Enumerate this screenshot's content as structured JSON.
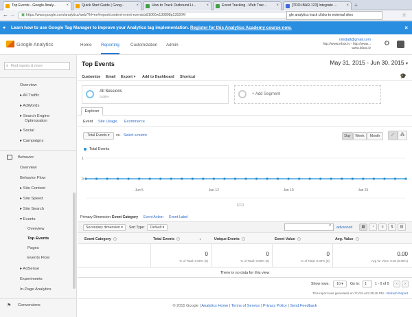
{
  "browser": {
    "tabs": [
      {
        "title": "Top Events - Google Analy...",
        "color": "#f4a400"
      },
      {
        "title": "Quick Start Guide | Goog...",
        "color": "#f4a400"
      },
      {
        "title": "How to Track Outbound Li...",
        "color": "#43a047"
      },
      {
        "title": "Event Tracking - Web Trac...",
        "color": "#43a047"
      },
      {
        "title": "[TOOLBAR-123] Integrate ...",
        "color": "#3f6ad8"
      }
    ],
    "url": "https://www.google.com/analytics/web/?hl=en#report/content-event-events/a81060w130898p135204/",
    "search_text": "gle analytics track clicks to external sites"
  },
  "banner": {
    "text": "Learn how to use Google Tag Manager to improve your Analytics tag implementation.",
    "link": "Register for this Analytics Academy course now."
  },
  "header": {
    "logo_text": "Google Analytics",
    "nav": [
      "Home",
      "Reporting",
      "Customization",
      "Admin"
    ],
    "active_nav": "Reporting",
    "account_email": "nimda8@gmail.com",
    "account_line2": "http://www.inbox.lv - http://www...",
    "account_line3": "www.inbox.lv"
  },
  "sidebar": {
    "search_placeholder": "Find reports & more",
    "items": [
      {
        "label": "Overview",
        "indent": 2
      },
      {
        "label": "▸ All Traffic",
        "indent": 2
      },
      {
        "label": "▸ AdWords",
        "indent": 2
      },
      {
        "label": "▸ Search Engine",
        "indent": 2
      },
      {
        "label": "Optimization",
        "indent": 3
      },
      {
        "label": "▸ Social",
        "indent": 2
      },
      {
        "label": "▸ Campaigns",
        "indent": 2
      },
      {
        "label": "Behavior",
        "indent": 1
      },
      {
        "label": "Overview",
        "indent": 2
      },
      {
        "label": "Behavior Flow",
        "indent": 2
      },
      {
        "label": "▸ Site Content",
        "indent": 2
      },
      {
        "label": "▸ Site Speed",
        "indent": 2
      },
      {
        "label": "▸ Site Search",
        "indent": 2
      },
      {
        "label": "▾ Events",
        "indent": 2
      },
      {
        "label": "Overview",
        "indent": 3
      },
      {
        "label": "Top Events",
        "indent": 3
      },
      {
        "label": "Pages",
        "indent": 3
      },
      {
        "label": "Events Flow",
        "indent": 3
      },
      {
        "label": "▸ AdSense",
        "indent": 2
      },
      {
        "label": "Experiments",
        "indent": 2
      },
      {
        "label": "In-Page Analytics",
        "indent": 2
      },
      {
        "label": "Conversions",
        "indent": 1
      }
    ]
  },
  "report": {
    "title": "Top Events",
    "date_range": "May 31, 2015 - Jun 30, 2015",
    "actions": [
      "Customize",
      "Email",
      "Export ▾",
      "Add to Dashboard",
      "Shortcut"
    ],
    "segment1_name": "All Sessions",
    "segment1_pct": "0.00%",
    "segment2": "+ Add Segment",
    "explorer_tab": "Explorer",
    "subtabs": [
      "Event",
      "Site Usage",
      "Ecommerce"
    ],
    "metric_select": "Total Events ▾",
    "vs": "vs.",
    "select_metric": "Select a metric",
    "periods": [
      "Day",
      "Week",
      "Month"
    ],
    "primary_dimension_label": "Primary Dimension:",
    "dimensions": [
      "Event Category",
      "Event Action",
      "Event Label"
    ],
    "secondary_dimension": "Secondary dimension ▾",
    "sort_type_label": "Sort Type:",
    "sort_type": "Default ▾",
    "advanced": "advanced",
    "columns": [
      "Event Category",
      "Total Events",
      "Unique Events",
      "Event Value",
      "Avg. Value"
    ],
    "totals": [
      "0",
      "0",
      "0",
      "0.00"
    ],
    "totals_sub": [
      "% of Total: 0.00% (0)",
      "% of Total: 0.00% (0)",
      "% of Total: 0.00% (0)",
      "Avg for View: 0.00 (0.00%)"
    ],
    "no_data": "There is no data for this view",
    "show_rows_label": "Show rows:",
    "show_rows": "10 ▾",
    "goto_label": "Go to:",
    "goto_value": "1",
    "page_info": "1 - 0 of 0",
    "generated": "This report was generated on 7/1/15 at 5:39:45 PM -",
    "refresh": "Refresh Report"
  },
  "chart_data": {
    "type": "line",
    "series": [
      {
        "name": "Total Events",
        "values": [
          0,
          0,
          0,
          0,
          0,
          0,
          0,
          0,
          0,
          0,
          0,
          0,
          0,
          0,
          0,
          0,
          0,
          0,
          0,
          0,
          0,
          0,
          0,
          0,
          0,
          0,
          0,
          0,
          0,
          0,
          0
        ]
      }
    ],
    "x_tick_labels": [
      "Jun 5",
      "Jun 12",
      "Jun 19",
      "Jun 26"
    ],
    "y_tick_labels": [
      "1",
      "0"
    ],
    "ylim": [
      0,
      1
    ],
    "color": "#1f8fd5"
  },
  "footer": {
    "items": [
      "© 2015 Google",
      "Analytics Home",
      "Terms of Service",
      "Privacy Policy",
      "Send Feedback"
    ]
  }
}
